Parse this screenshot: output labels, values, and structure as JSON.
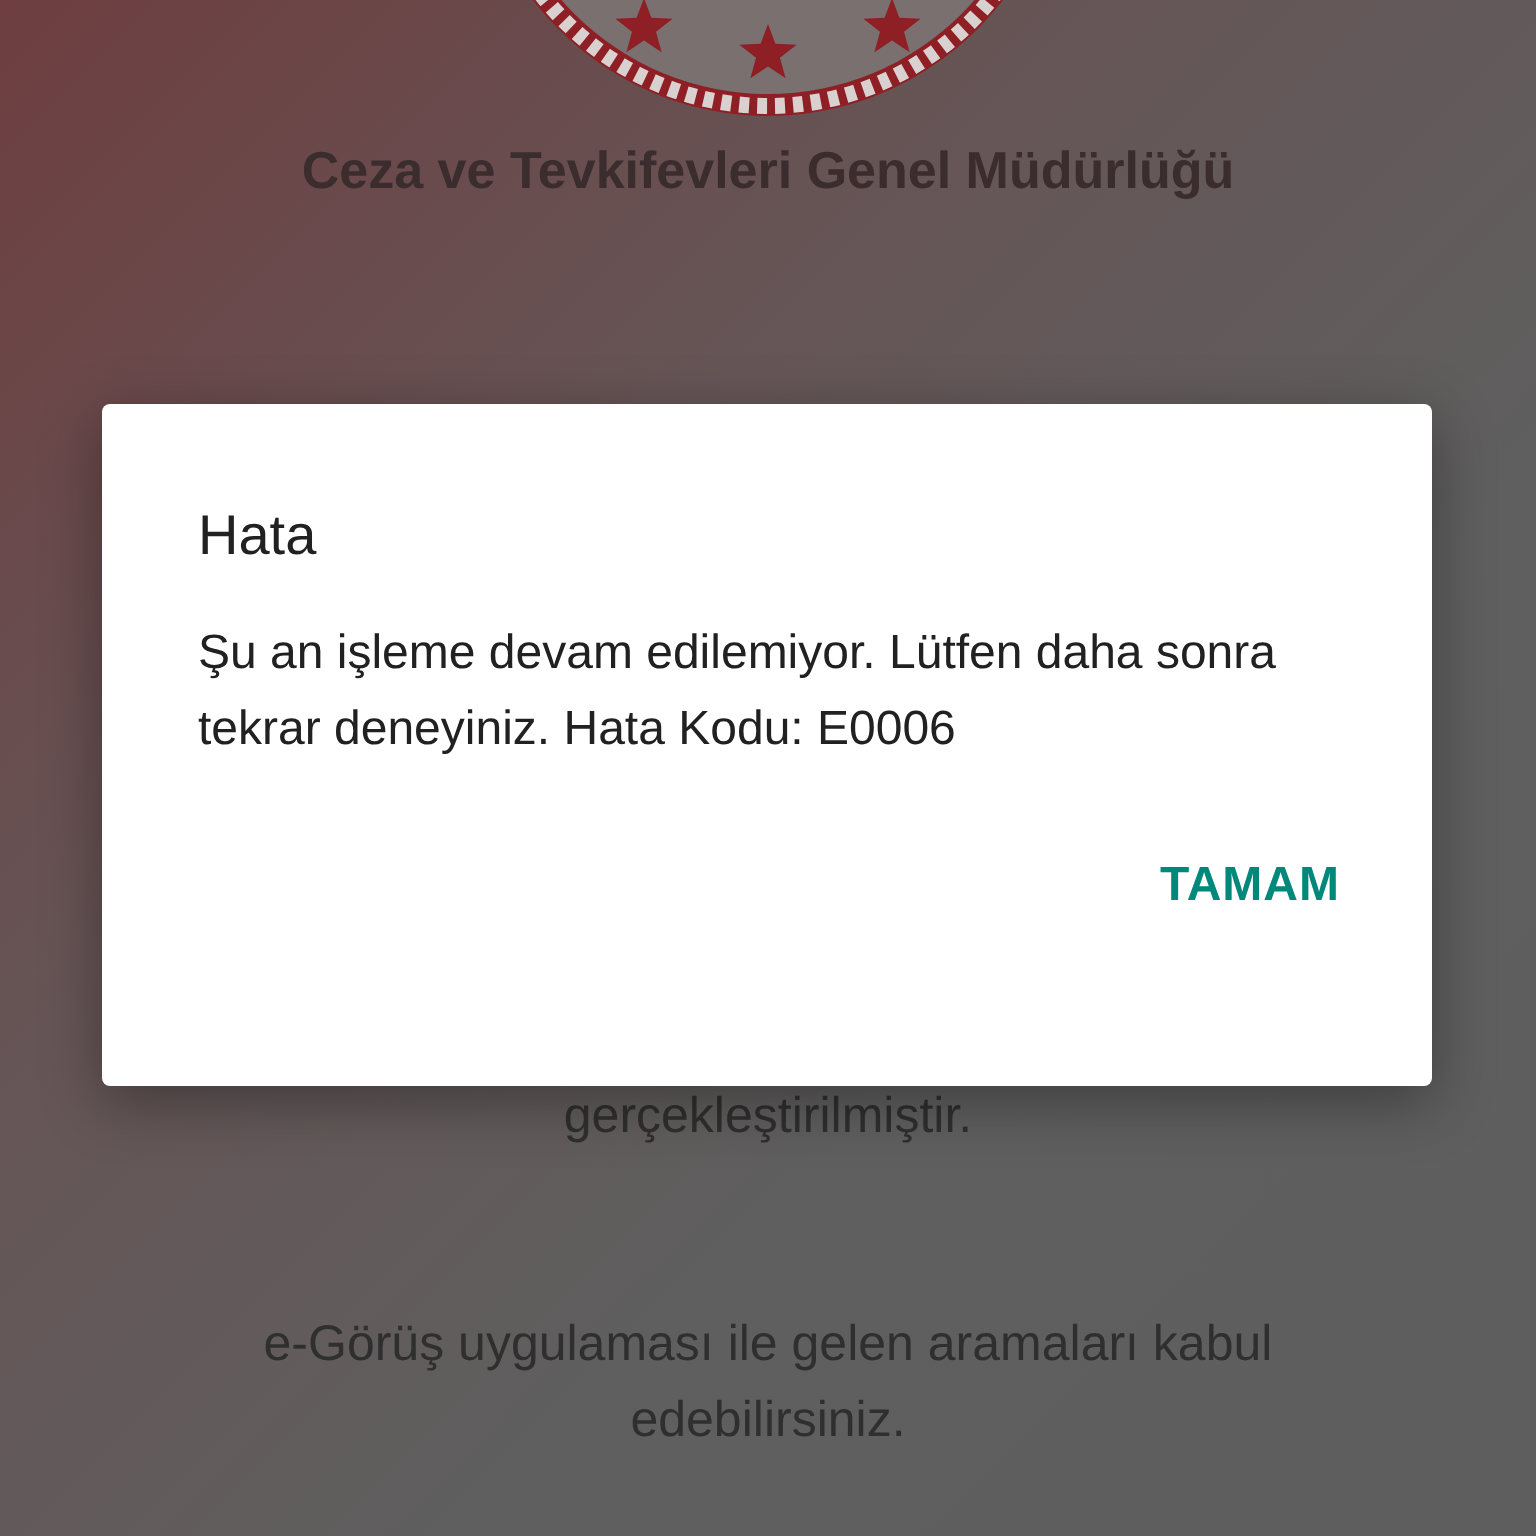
{
  "header": {
    "title": "Ceza ve Tevkifevleri Genel Müdürlüğü"
  },
  "background_texts": [
    "gerçekleştirilmiştir.",
    "e-Görüş uygulaması ile gelen aramaları kabul edebilirsiniz."
  ],
  "dialog": {
    "title": "Hata",
    "message": "Şu an işleme devam edilemiyor. Lütfen daha sonra tekrar deneyiniz. Hata Kodu: E0006",
    "buttons": [
      "TAMAM"
    ]
  }
}
